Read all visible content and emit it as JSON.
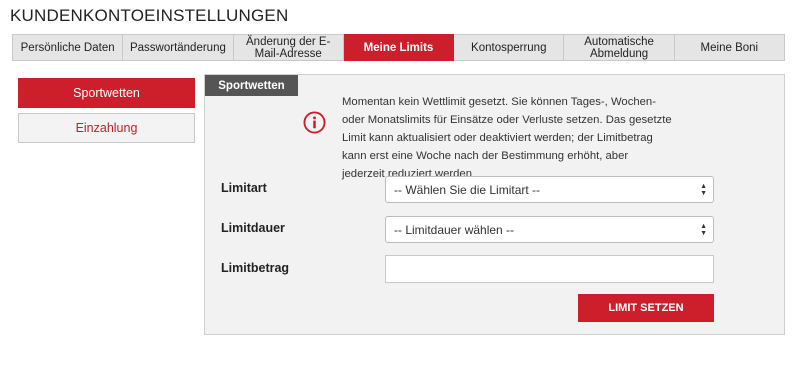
{
  "page": {
    "title": "KUNDENKONTOEINSTELLUNGEN"
  },
  "tabs": [
    {
      "label": "Persönliche Daten",
      "active": false
    },
    {
      "label": "Passwortänderung",
      "active": false
    },
    {
      "label": "Änderung der E-Mail-Adresse",
      "active": false
    },
    {
      "label": "Meine Limits",
      "active": true
    },
    {
      "label": "Kontosperrung",
      "active": false
    },
    {
      "label": "Automatische Abmeldung",
      "active": false
    },
    {
      "label": "Meine Boni",
      "active": false
    }
  ],
  "sidebar": {
    "sportwetten_label": "Sportwetten",
    "einzahlung_label": "Einzahlung"
  },
  "panel": {
    "tab_label": "Sportwetten",
    "info_icon": "info-circle-icon",
    "info_text": "Momentan kein Wettlimit gesetzt. Sie können Tages-, Wochen- oder Monatslimits für Einsätze oder Verluste setzen. Das gesetzte Limit kann aktualisiert oder deaktiviert werden; der Limitbetrag kann erst eine Woche nach der Bestimmung erhöht, aber jederzeit reduziert werden"
  },
  "form": {
    "limitart_label": "Limitart",
    "limitart_value": "-- Wählen Sie die Limitart --",
    "limitdauer_label": "Limitdauer",
    "limitdauer_value": "-- Limitdauer wählen --",
    "limitbetrag_label": "Limitbetrag",
    "limitbetrag_value": "",
    "submit_label": "LIMIT SETZEN"
  },
  "colors": {
    "accent": "#cc1f2b",
    "panel_tab": "#555555",
    "panel_bg": "#f2f2f2"
  }
}
